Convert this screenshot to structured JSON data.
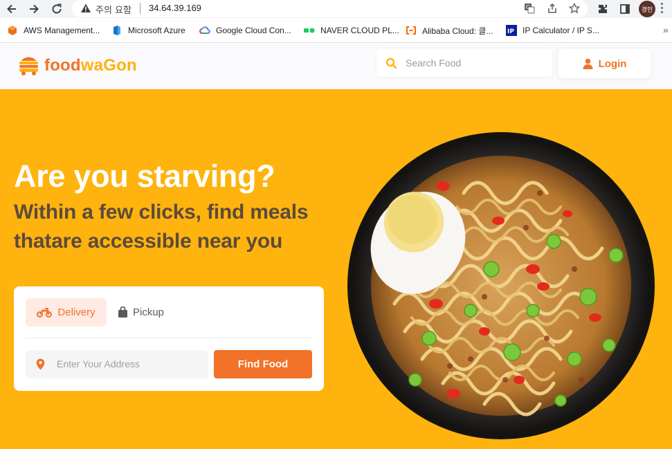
{
  "browser": {
    "security_status": "주의 요함",
    "url": "34.64.39.169",
    "profile_initials": "경민"
  },
  "bookmarks": [
    {
      "label": "AWS Management...",
      "icon": "aws-icon"
    },
    {
      "label": "Microsoft Azure",
      "icon": "azure-icon"
    },
    {
      "label": "Google Cloud Con...",
      "icon": "google-cloud-icon"
    },
    {
      "label": "NAVER CLOUD PL...",
      "icon": "naver-cloud-icon"
    },
    {
      "label": "Alibaba Cloud: 클...",
      "icon": "alibaba-cloud-icon"
    },
    {
      "label": "IP Calculator / IP S...",
      "icon": "ip-calculator-icon"
    }
  ],
  "header": {
    "logo_part1": "food",
    "logo_part2": "waGon",
    "search_placeholder": "Search Food",
    "login_label": "Login"
  },
  "hero": {
    "title": "Are you starving?",
    "subtitle": "Within a few clicks, find meals thatare accessible near you",
    "tabs": [
      {
        "label": "Delivery",
        "icon": "motorbike-icon",
        "active": true
      },
      {
        "label": "Pickup",
        "icon": "shopping-bag-icon",
        "active": false
      }
    ],
    "address_placeholder": "Enter Your Address",
    "find_button": "Find Food"
  },
  "colors": {
    "brand_orange": "#f17228",
    "brand_yellow": "#ffb30e",
    "delivery_tab_bg": "#ffeae4"
  }
}
